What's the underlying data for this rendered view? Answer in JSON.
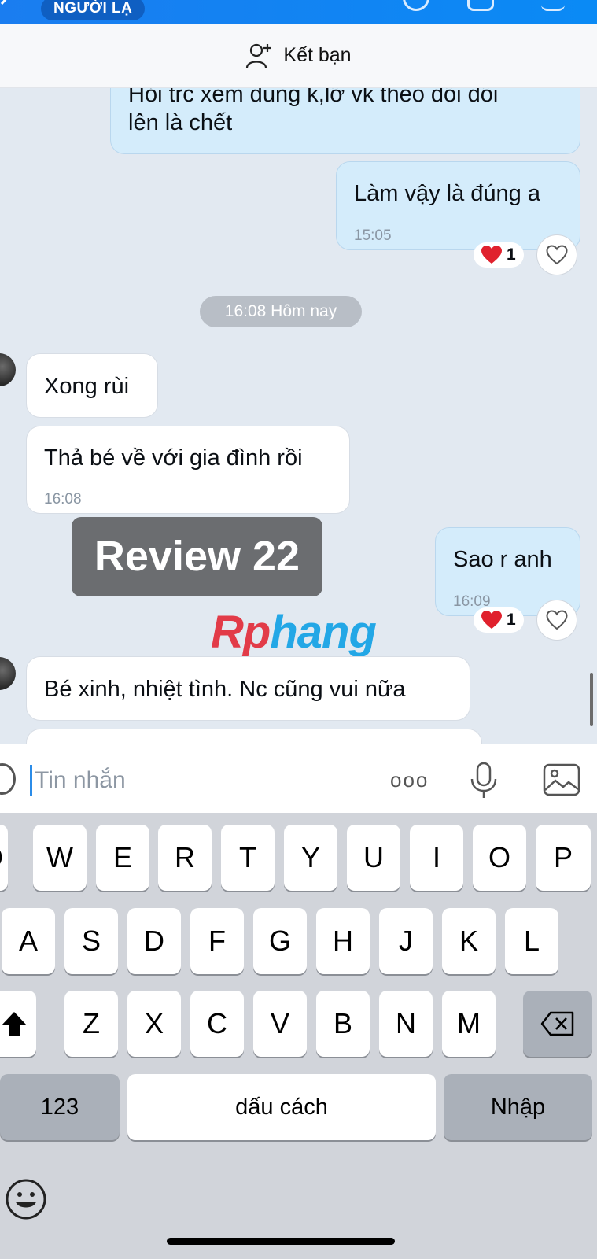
{
  "header": {
    "stranger_badge": "NGƯỜI LẠ",
    "add_friend_label": "Kết bạn"
  },
  "messages": {
    "partial_top_line1": "Hỏi trc xem đúng k,lỡ vk theo dõi dõi",
    "partial_top_line2": "lên là chết",
    "me_1_text": "Làm vậy là đúng a",
    "me_1_time": "15:05",
    "me_1_reaction_count": "1",
    "divider_time": "16:08 Hôm nay",
    "them_1_text": "Xong rùi",
    "them_2_text": "Thả bé về với gia đình rồi",
    "them_2_time": "16:08",
    "me_2_text": "Sao r anh",
    "me_2_time": "16:09",
    "me_2_reaction_count": "1",
    "them_3_text": "Bé xinh, nhiệt tình. Nc cũng vui nữa"
  },
  "overlay": {
    "review_label": "Review 22",
    "watermark_main": "Rp",
    "watermark_rest": "hang"
  },
  "input": {
    "placeholder": "Tin nhắn",
    "more_dots": "ooo"
  },
  "keyboard": {
    "row1": [
      "Q",
      "W",
      "E",
      "R",
      "T",
      "Y",
      "U",
      "I",
      "O",
      "P"
    ],
    "row2": [
      "A",
      "S",
      "D",
      "F",
      "G",
      "H",
      "J",
      "K",
      "L"
    ],
    "row3": [
      "Z",
      "X",
      "C",
      "V",
      "B",
      "N",
      "M"
    ],
    "numbers_key": "123",
    "space_key": "dấu cách",
    "enter_key": "Nhập"
  },
  "colors": {
    "accent": "#1a7df0",
    "my_bubble": "#d4ecfb",
    "their_bubble": "#ffffff",
    "chat_background": "#e2e9f1"
  },
  "icons": {
    "add_friend": "add-person-icon",
    "like": "heart-outline-icon",
    "reaction": "red-heart-icon",
    "mic": "microphone-icon",
    "gallery": "image-icon",
    "sticker": "sticker-icon",
    "emoji": "emoji-icon",
    "shift": "shift-icon",
    "backspace": "backspace-icon"
  }
}
